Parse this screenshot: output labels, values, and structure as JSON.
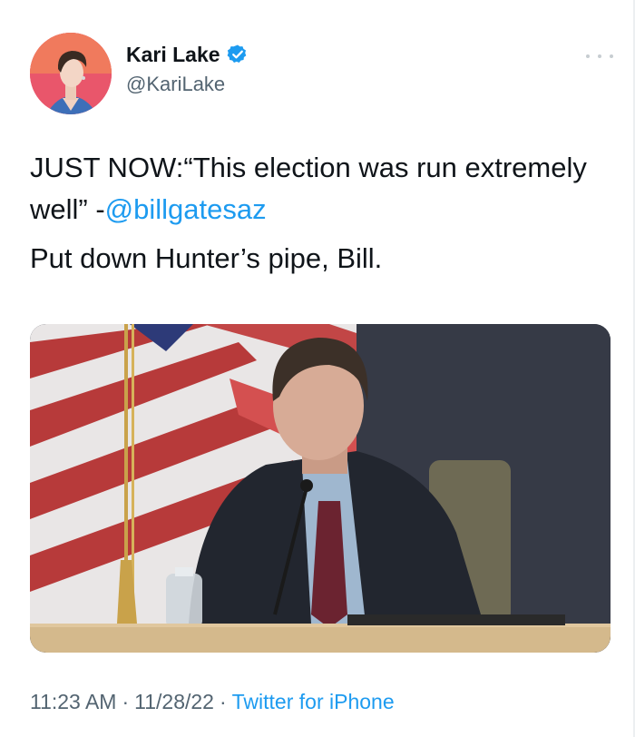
{
  "author": {
    "display_name": "Kari Lake",
    "handle": "@KariLake",
    "verified_icon": "verified-badge-icon",
    "accent": "#1d9bf0"
  },
  "tweet": {
    "line1_prefix": "JUST NOW:“This election was run extremely well” -",
    "mention": "@billgatesaz",
    "line2": "Put down Hunter’s pipe, Bill."
  },
  "meta": {
    "time": "11:23 AM",
    "separator": "·",
    "date": "11/28/22",
    "source": "Twitter for iPhone"
  },
  "media": {
    "type": "photo",
    "icon": "photo-icon"
  },
  "menu": {
    "icon": "more-options-icon"
  }
}
